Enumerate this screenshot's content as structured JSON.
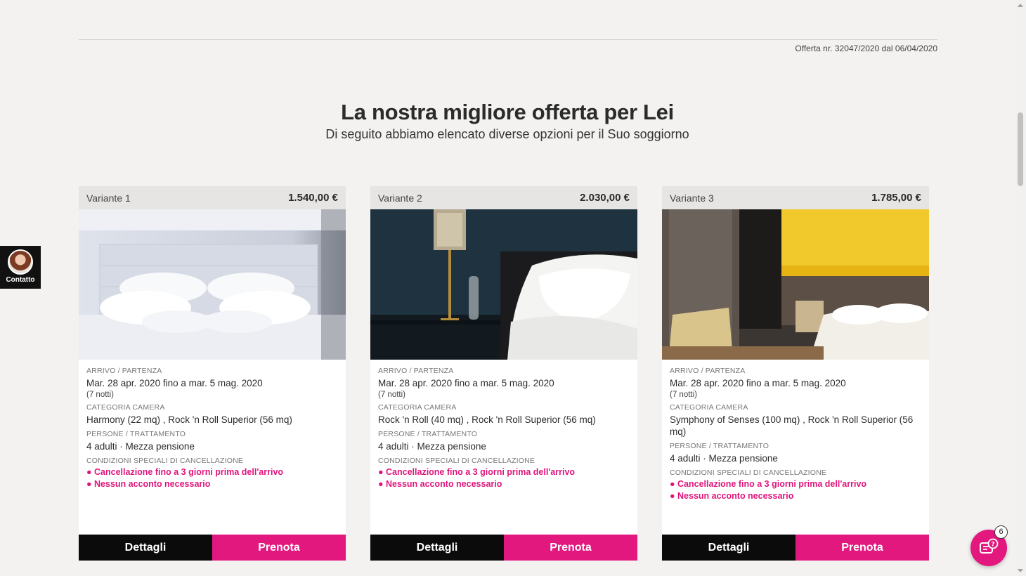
{
  "offer": {
    "number_text": "Offerta nr. 32047/2020 dal 06/04/2020"
  },
  "heading": {
    "title": "La nostra migliore offerta per Lei",
    "subtitle": "Di seguito abbiamo elencato diverse opzioni per il Suo soggiorno"
  },
  "labels": {
    "arrival": "ARRIVO / PARTENZA",
    "room": "CATEGORIA CAMERA",
    "persons": "PERSONE / TRATTAMENTO",
    "conditions": "CONDIZIONI SPECIALI DI CANCELLAZIONE",
    "details_button": "Dettagli",
    "book_button": "Prenota"
  },
  "variants": [
    {
      "name": "Variante 1",
      "price": "1.540,00 €",
      "dates": "Mar. 28 apr. 2020 fino a mar. 5 mag. 2020",
      "nights": "(7 notti)",
      "rooms": "Harmony (22 mq) , Rock 'n Roll Superior (56 mq)",
      "persons": "4 adulti · Mezza pensione",
      "conditions": [
        "● Cancellazione fino a 3 giorni prima dell'arrivo",
        "● Nessun acconto necessario"
      ]
    },
    {
      "name": "Variante 2",
      "price": "2.030,00 €",
      "dates": "Mar. 28 apr. 2020 fino a mar. 5 mag. 2020",
      "nights": "(7 notti)",
      "rooms": "Rock 'n Roll (40 mq) , Rock 'n Roll Superior (56 mq)",
      "persons": "4 adulti · Mezza pensione",
      "conditions": [
        "● Cancellazione fino a 3 giorni prima dell'arrivo",
        "● Nessun acconto necessario"
      ]
    },
    {
      "name": "Variante 3",
      "price": "1.785,00 €",
      "dates": "Mar. 28 apr. 2020 fino a mar. 5 mag. 2020",
      "nights": "(7 notti)",
      "rooms": "Symphony of Senses (100 mq) , Rock 'n Roll Superior (56 mq)",
      "persons": "4 adulti · Mezza pensione",
      "conditions": [
        "● Cancellazione fino a 3 giorni prima dell'arrivo",
        "● Nessun acconto necessario"
      ]
    }
  ],
  "contact": {
    "label": "Contatto"
  },
  "chat": {
    "badge_count": "6",
    "icon": "chat-help-icon"
  },
  "colors": {
    "accent": "#e2187f",
    "dark": "#0b0b0b",
    "background": "#f3f2f0"
  }
}
